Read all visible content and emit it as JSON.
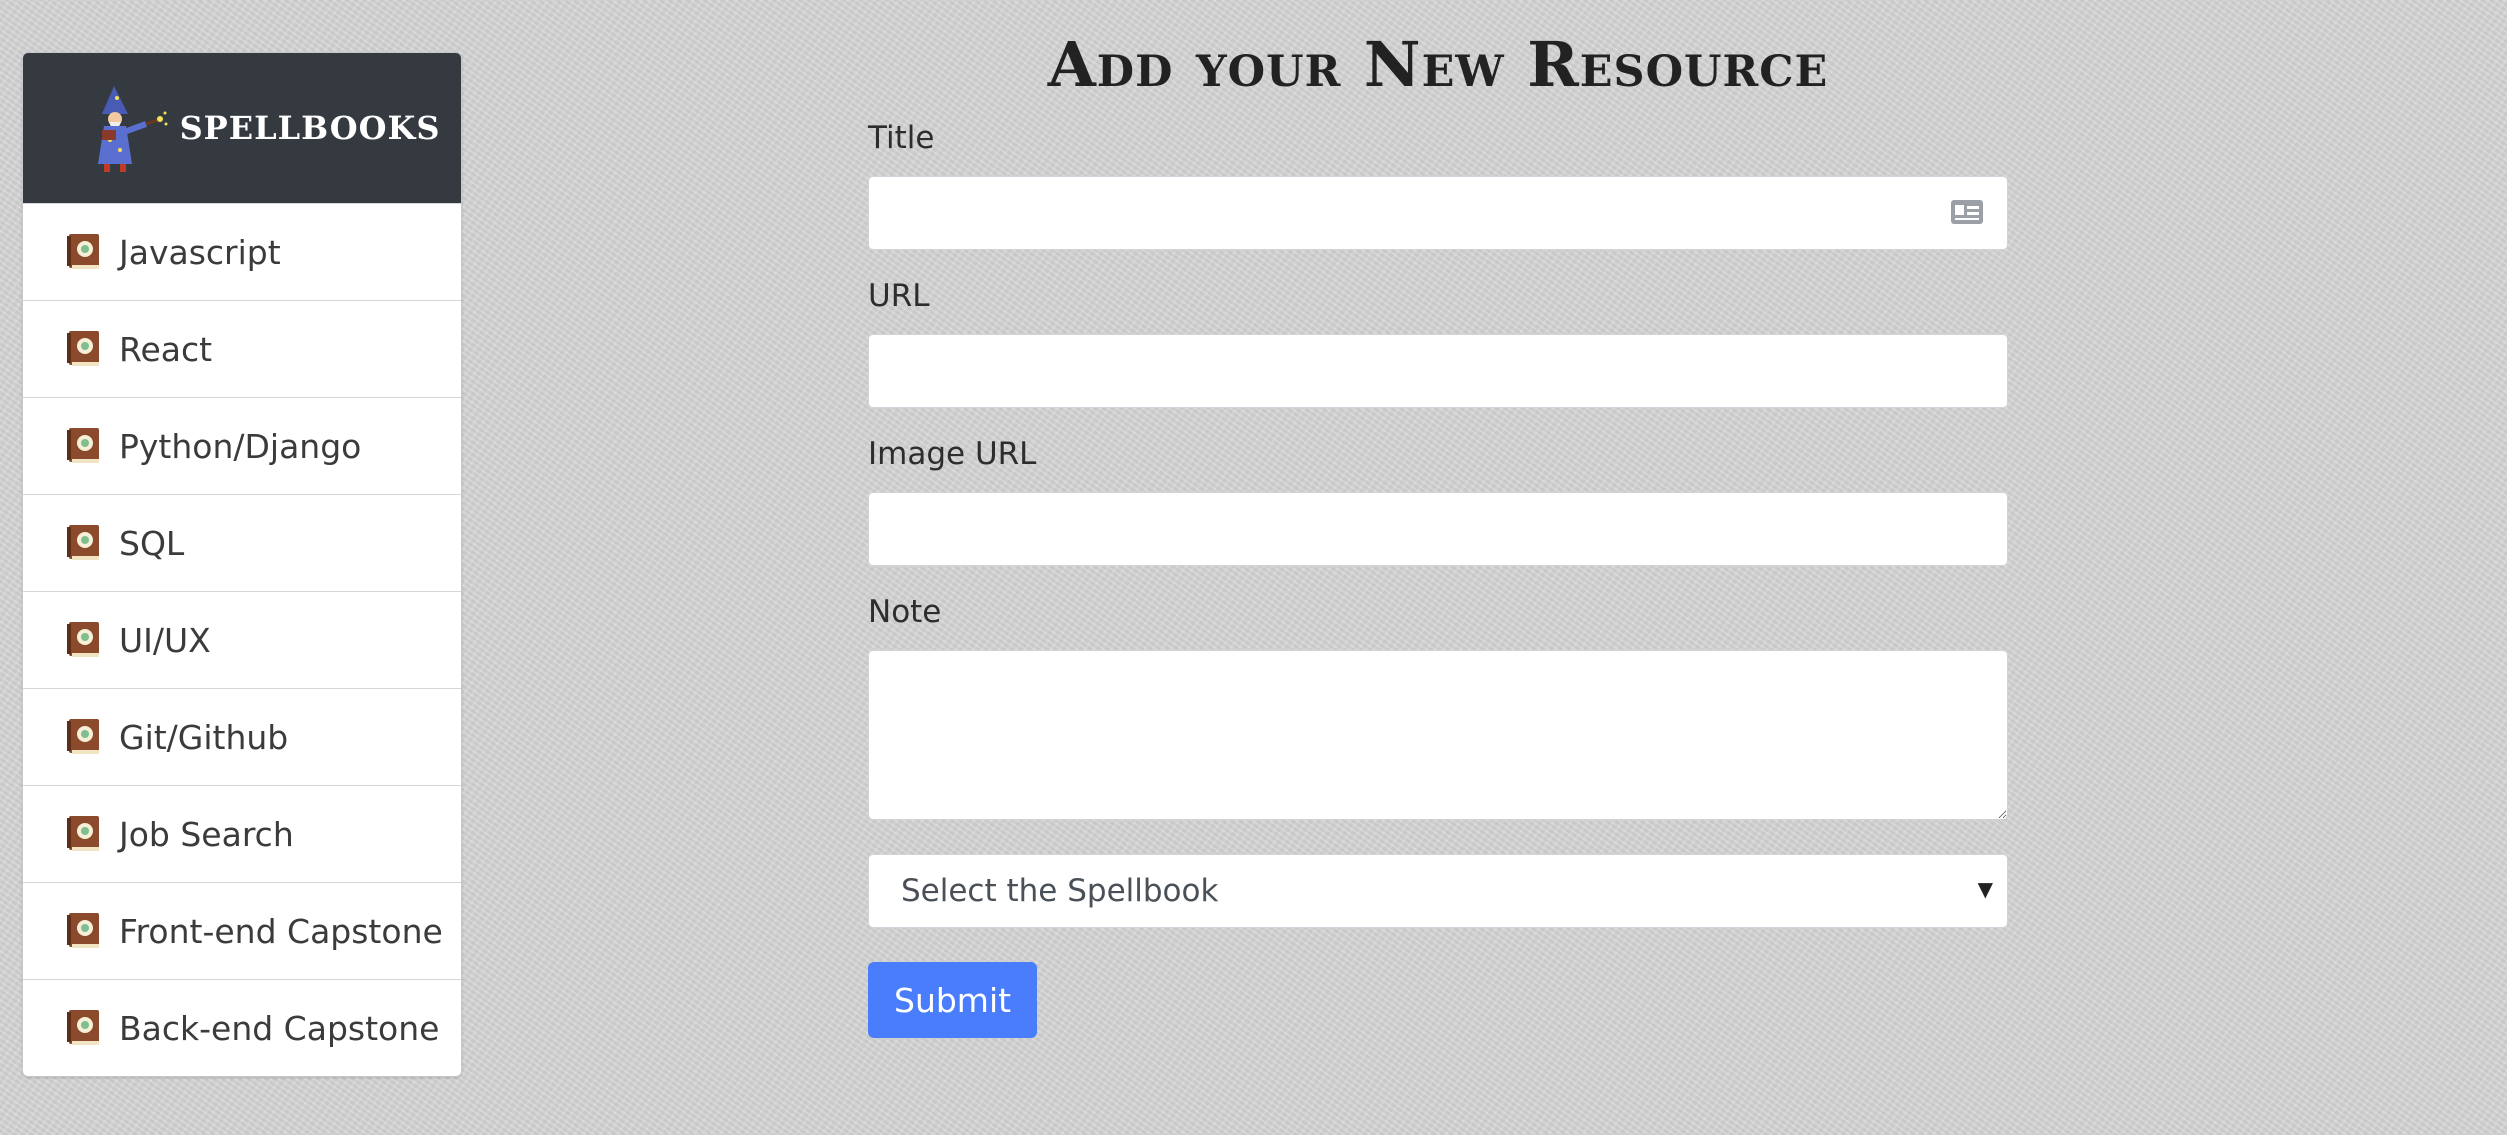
{
  "sidebar": {
    "brand": "SPELLBOOKS",
    "logo_icon": "wizard-logo",
    "item_icon": "spellbook-icon",
    "items": [
      {
        "label": "Javascript"
      },
      {
        "label": "React"
      },
      {
        "label": "Python/Django"
      },
      {
        "label": "SQL"
      },
      {
        "label": "UI/UX"
      },
      {
        "label": "Git/Github"
      },
      {
        "label": "Job Search"
      },
      {
        "label": "Front-end Capstone"
      },
      {
        "label": "Back-end Capstone"
      }
    ]
  },
  "main": {
    "title": "Add your New Resource",
    "form": {
      "title_label": "Title",
      "title_value": "",
      "url_label": "URL",
      "url_value": "",
      "image_url_label": "Image URL",
      "image_url_value": "",
      "note_label": "Note",
      "note_value": "",
      "spellbook_select": "Select the Spellbook",
      "submit_label": "Submit"
    }
  },
  "colors": {
    "sidebar_header": "#343a40",
    "submit_button": "#4a7dfc",
    "background": "#d4d4d4"
  }
}
